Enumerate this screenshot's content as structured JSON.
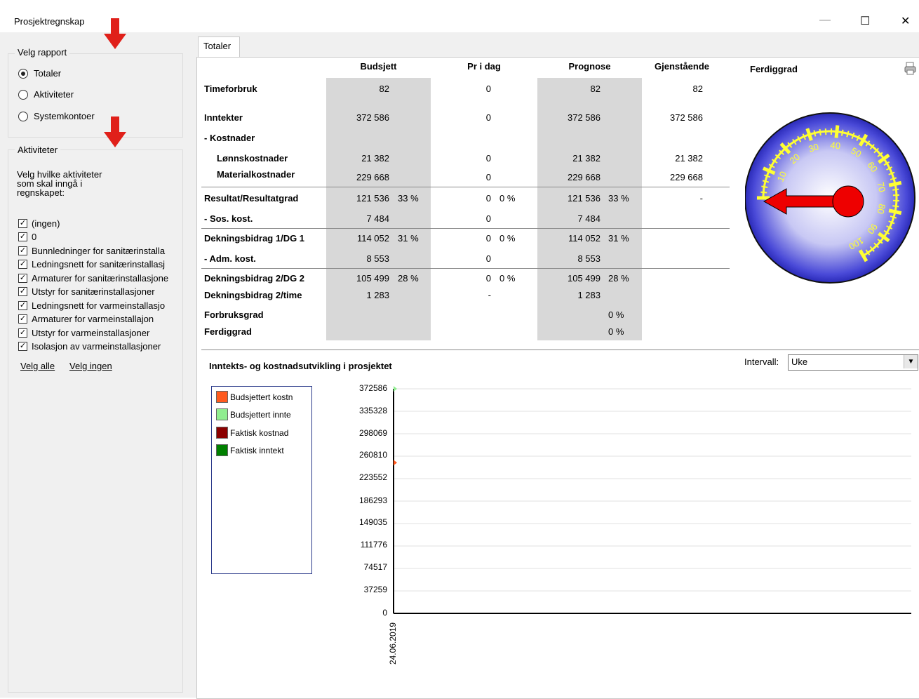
{
  "window": {
    "title": "Prosjektregnskap",
    "minimize": "—",
    "maximize": "☐",
    "close": "✕"
  },
  "left": {
    "report_group": "Velg rapport",
    "radios": [
      {
        "label": "Totaler",
        "selected": true
      },
      {
        "label": "Aktiviteter",
        "selected": false
      },
      {
        "label": "Systemkontoer",
        "selected": false
      }
    ],
    "activities_group": "Aktiviteter",
    "instructions": [
      "Velg hvilke aktiviteter",
      "som skal inngå i",
      "regnskapet:"
    ],
    "checkboxes": [
      "(ingen)",
      "0",
      "Bunnledninger for sanitærinstalla",
      "Ledningsnett for sanitærinstallasj",
      "Armaturer for sanitærinstallasjone",
      "Utstyr for sanitærinstallasjoner",
      "Ledningsnett for varmeinstallasjo",
      "Armaturer for varmeinstallajon",
      "Utstyr for varmeinstallasjoner",
      "Isolasjon av varmeinstallasjoner"
    ],
    "select_all": "Velg alle",
    "select_none": "Velg ingen"
  },
  "tab": "Totaler",
  "table": {
    "headers": {
      "budget": "Budsjett",
      "today": "Pr i dag",
      "forecast": "Prognose",
      "remaining": "Gjenstående"
    },
    "rows": {
      "timer": {
        "label": "Timeforbruk",
        "b": "82",
        "t": "0",
        "f": "82",
        "r": "82"
      },
      "inntekter": {
        "label": "Inntekter",
        "b": "372 586",
        "t": "0",
        "f": "372 586",
        "r": "372 586"
      },
      "kostnader": {
        "label": "- Kostnader"
      },
      "lonn": {
        "label": "Lønnskostnader",
        "b": "21 382",
        "t": "0",
        "f": "21 382",
        "r": "21 382"
      },
      "mat": {
        "label": "Materialkostnader",
        "b": "229 668",
        "t": "0",
        "f": "229 668",
        "r": "229 668"
      },
      "res": {
        "label": "Resultat/Resultatgrad",
        "b": "121 536",
        "bp": "33 %",
        "t": "0",
        "tp": "0 %",
        "f": "121 536",
        "fp": "33 %",
        "r": "-"
      },
      "sos": {
        "label": "- Sos. kost.",
        "b": "7 484",
        "t": "0",
        "f": "7 484"
      },
      "db1": {
        "label": "Dekningsbidrag 1/DG 1",
        "b": "114 052",
        "bp": "31 %",
        "t": "0",
        "tp": "0 %",
        "f": "114 052",
        "fp": "31 %"
      },
      "adm": {
        "label": "- Adm. kost.",
        "b": "8 553",
        "t": "0",
        "f": "8 553"
      },
      "db2": {
        "label": "Dekningsbidrag 2/DG 2",
        "b": "105 499",
        "bp": "28 %",
        "t": "0",
        "tp": "0 %",
        "f": "105 499",
        "fp": "28 %"
      },
      "db2t": {
        "label": "Dekningsbidrag 2/time",
        "b": "1 283",
        "t": "-",
        "f": "1 283"
      },
      "forbruk": {
        "label": "Forbruksgrad",
        "fp": "0 %"
      },
      "ferdig": {
        "label": "Ferdiggrad",
        "fp": "0 %"
      }
    }
  },
  "gauge": {
    "title": "Ferdiggrad",
    "value": 0,
    "ticks": [
      "0",
      "10",
      "20",
      "30",
      "40",
      "50",
      "60",
      "70",
      "80",
      "90",
      "100"
    ],
    "face_color": "#3333cc",
    "needle_color": "#ee0000",
    "tick_color": "#ffff33"
  },
  "chart": {
    "title": "Inntekts- og kostnadsutvikling i prosjektet",
    "interval_label": "Intervall:",
    "interval_value": "Uke",
    "legend": [
      {
        "name": "Budsjettert kostn",
        "color": "#ff5a1e"
      },
      {
        "name": "Budsjettert innte",
        "color": "#90ee90"
      },
      {
        "name": "Faktisk kostnad",
        "color": "#8b0000"
      },
      {
        "name": "Faktisk inntekt",
        "color": "#008000"
      }
    ],
    "y_ticks": [
      "372586",
      "335328",
      "298069",
      "260810",
      "223552",
      "186293",
      "149035",
      "111776",
      "74517",
      "37259",
      "0"
    ],
    "x_label": "24.06.2019"
  },
  "chart_data": {
    "type": "line",
    "title": "Inntekts- og kostnadsutvikling i prosjektet",
    "x": [
      "24.06.2019"
    ],
    "ylim": [
      0,
      372586
    ],
    "series": [
      {
        "name": "Budsjettert kostn",
        "values": [
          250000
        ]
      },
      {
        "name": "Budsjettert innte",
        "values": [
          372586
        ]
      },
      {
        "name": "Faktisk kostnad",
        "values": [
          0
        ]
      },
      {
        "name": "Faktisk inntekt",
        "values": [
          0
        ]
      }
    ],
    "legend": "left",
    "grid": true
  }
}
